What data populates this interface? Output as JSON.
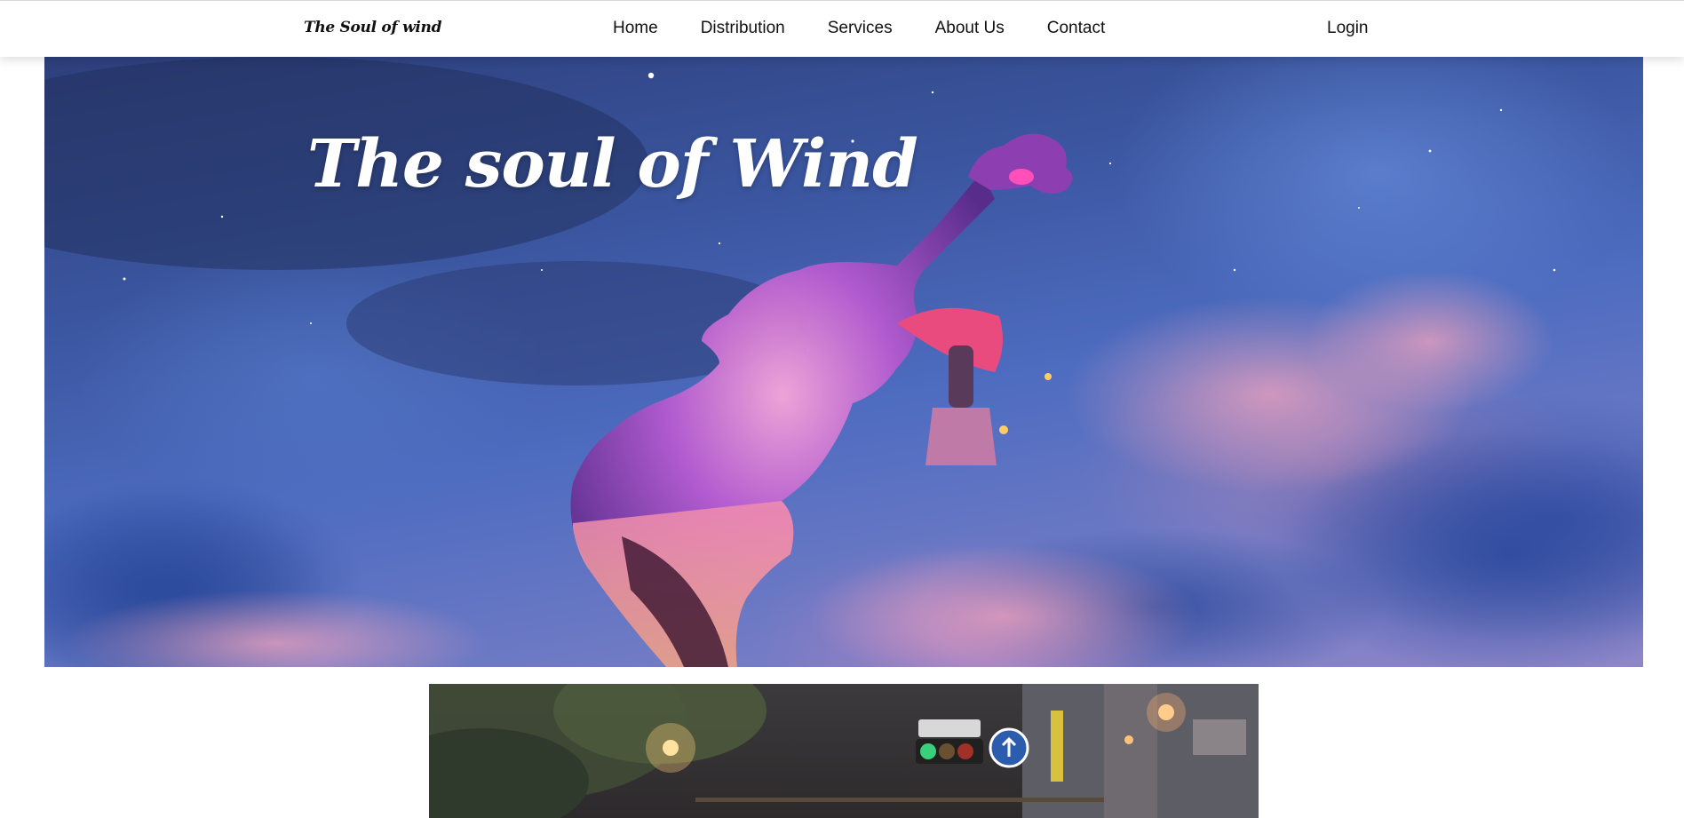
{
  "navbar": {
    "brand": "The Soul of wind",
    "links": [
      "Home",
      "Distribution",
      "Services",
      "About Us",
      "Contact"
    ],
    "login": "Login"
  },
  "hero": {
    "title": "The soul of Wind"
  },
  "colors": {
    "sky_dark": "#2d3f7c",
    "sky_mid": "#4e6cc0",
    "cloud_pink": "#e88cae",
    "violin_purple": "#9a4fc4",
    "umbrella_pink": "#e94b7f",
    "nav_text": "#111111"
  }
}
